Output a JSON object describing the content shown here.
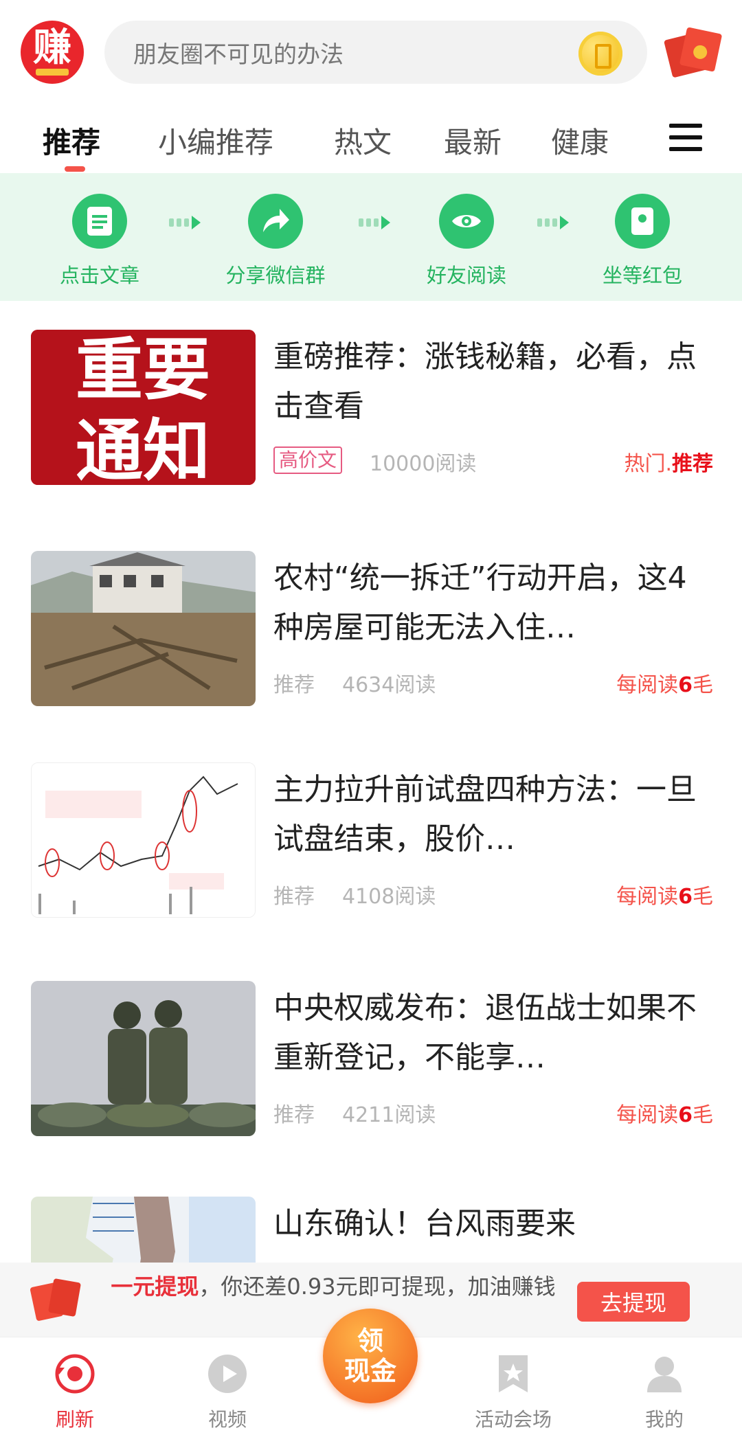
{
  "header": {
    "logo_text": "赚",
    "search_placeholder": "朋友圈不可见的办法"
  },
  "tabs": [
    "推荐",
    "小编推荐",
    "热文",
    "最新",
    "健康"
  ],
  "steps": [
    "点击文章",
    "分享微信群",
    "好友阅读",
    "坐等红包"
  ],
  "articles": [
    {
      "title": "重磅推荐：涨钱秘籍，必看，点击查看",
      "thumb_text": "重要通知",
      "tag": "高价文",
      "reads": "10000阅读",
      "reward_prefix": "热门.",
      "reward_strong": "推荐",
      "reward_suffix": ""
    },
    {
      "title": "农村“统一拆迁”行动开启，这4种房屋可能无法入住…",
      "tag": "推荐",
      "reads": "4634阅读",
      "reward_prefix": "每阅读",
      "reward_strong": "6",
      "reward_suffix": "毛"
    },
    {
      "title": "主力拉升前试盘四种方法：一旦试盘结束，股价…",
      "tag": "推荐",
      "reads": "4108阅读",
      "reward_prefix": "每阅读",
      "reward_strong": "6",
      "reward_suffix": "毛"
    },
    {
      "title": "中央权威发布：退伍战士如果不重新登记，不能享…",
      "tag": "推荐",
      "reads": "4211阅读",
      "reward_prefix": "每阅读",
      "reward_strong": "6",
      "reward_suffix": "毛"
    },
    {
      "title": "山东确认！台风雨要来"
    }
  ],
  "withdraw": {
    "highlight": "一元提现",
    "message": "，你还差0.93元即可提现，加油赚钱",
    "button": "去提现"
  },
  "bottom_nav": {
    "refresh": "刷新",
    "video": "视频",
    "center_line1": "领",
    "center_line2": "现金",
    "activity": "活动会场",
    "mine": "我的"
  },
  "colors": {
    "accent": "#f4534a",
    "green": "#2fc371",
    "banner_bg": "#e8f8ee"
  }
}
